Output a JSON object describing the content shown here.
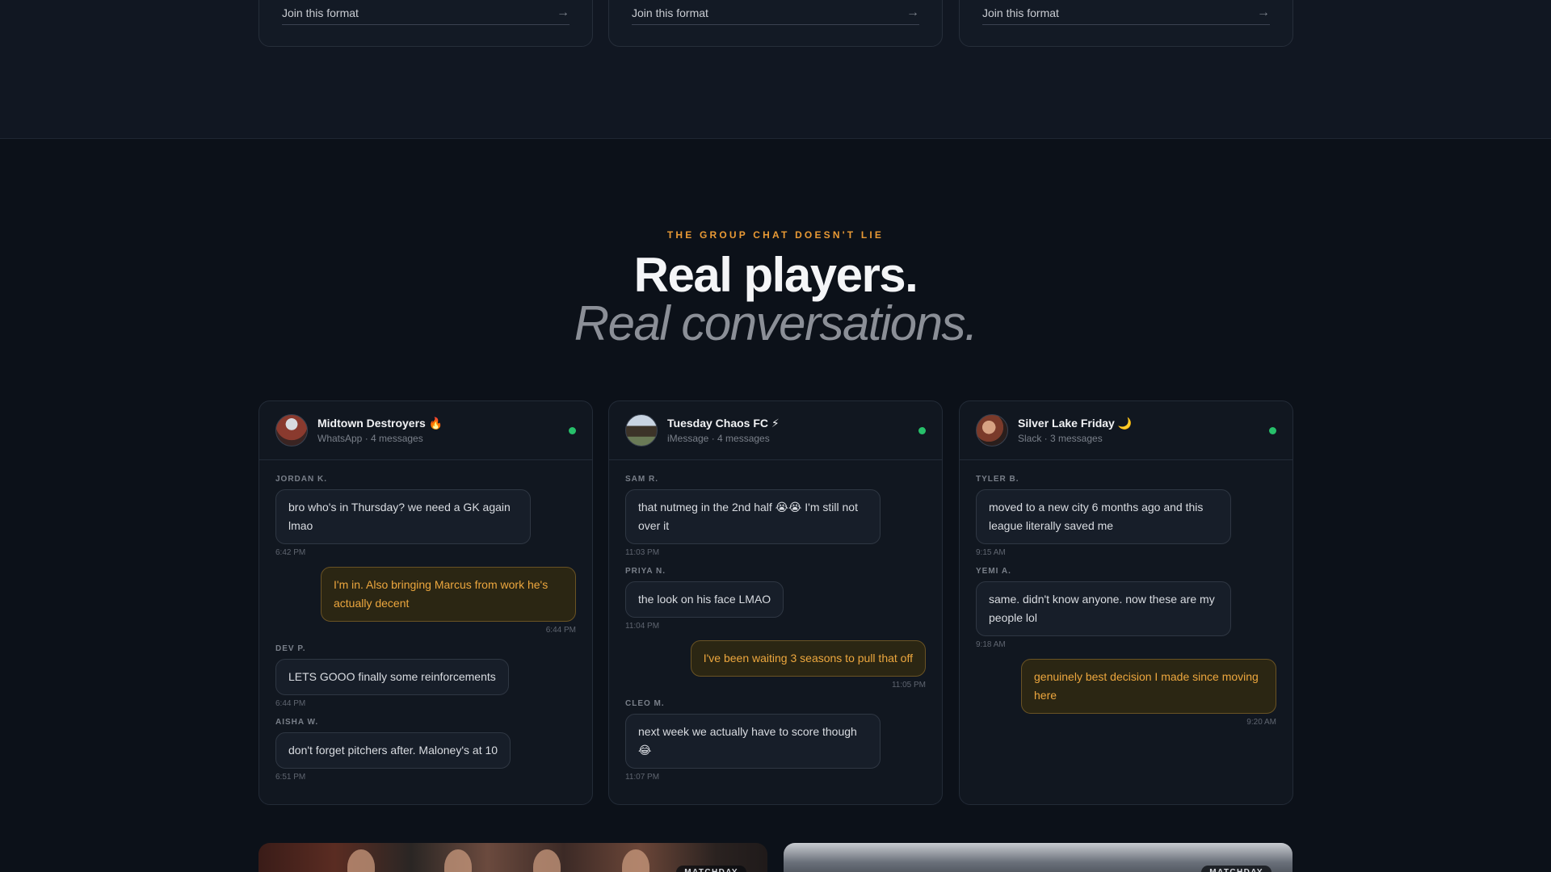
{
  "formats": [
    {
      "label": "Join this format",
      "arrow": "→"
    },
    {
      "label": "Join this format",
      "arrow": "→"
    },
    {
      "label": "Join this format",
      "arrow": "→"
    }
  ],
  "section": {
    "eyebrow": "THE GROUP CHAT DOESN'T LIE",
    "headline": "Real players.",
    "subheadline": "Real conversations."
  },
  "chats": [
    {
      "title": "Midtown Destroyers 🔥",
      "meta": "WhatsApp · 4 messages",
      "messages": [
        {
          "sender": "JORDAN K.",
          "text": "bro who's in Thursday? we need a GK again lmao",
          "time": "6:42 PM",
          "mine": false
        },
        {
          "sender": "",
          "text": "I'm in. Also bringing Marcus from work he's actually decent",
          "time": "6:44 PM",
          "mine": true
        },
        {
          "sender": "DEV P.",
          "text": "LETS GOOO finally some reinforcements",
          "time": "6:44 PM",
          "mine": false
        },
        {
          "sender": "AISHA W.",
          "text": "don't forget pitchers after. Maloney's at 10",
          "time": "6:51 PM",
          "mine": false
        }
      ]
    },
    {
      "title": "Tuesday Chaos FC ⚡",
      "meta": "iMessage · 4 messages",
      "messages": [
        {
          "sender": "SAM R.",
          "text": "that nutmeg in the 2nd half 😭😭 I'm still not over it",
          "time": "11:03 PM",
          "mine": false
        },
        {
          "sender": "PRIYA N.",
          "text": "the look on his face LMAO",
          "time": "11:04 PM",
          "mine": false
        },
        {
          "sender": "",
          "text": "I've been waiting 3 seasons to pull that off",
          "time": "11:05 PM",
          "mine": true
        },
        {
          "sender": "CLEO M.",
          "text": "next week we actually have to score though 😂",
          "time": "11:07 PM",
          "mine": false
        }
      ]
    },
    {
      "title": "Silver Lake Friday 🌙",
      "meta": "Slack · 3 messages",
      "messages": [
        {
          "sender": "TYLER B.",
          "text": "moved to a new city 6 months ago and this league literally saved me",
          "time": "9:15 AM",
          "mine": false
        },
        {
          "sender": "YEMI A.",
          "text": "same. didn't know anyone. now these are my people lol",
          "time": "9:18 AM",
          "mine": false
        },
        {
          "sender": "",
          "text": "genuinely best decision I made since moving here",
          "time": "9:20 AM",
          "mine": true
        }
      ]
    }
  ],
  "photos": [
    {
      "tag": "MATCHDAY"
    },
    {
      "tag": "MATCHDAY"
    }
  ],
  "colors": {
    "accent": "#e99a35",
    "online": "#27c06a",
    "background": "#0c1119"
  }
}
